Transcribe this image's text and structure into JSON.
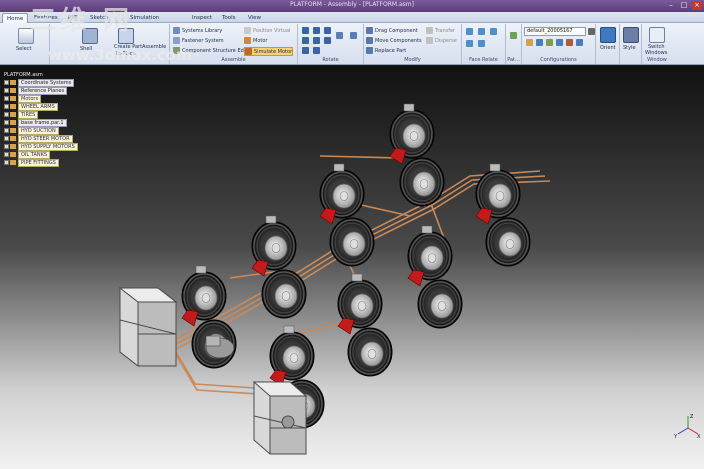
{
  "window": {
    "title": "PLATFORM - Assembly - [PLATFORM.asm]"
  },
  "menu": {
    "tabs": [
      "Home",
      "Features",
      "PMI",
      "Sketch",
      "Simulation",
      "Inspect",
      "Tools",
      "View"
    ]
  },
  "ribbon": {
    "select_label": "Select",
    "component_label": "Shell",
    "create_part_label": "Create Part",
    "in_place_label": "In-Place",
    "assemble_label": "Assemble",
    "systems_library_label": "Systems Library",
    "fastener_system_label": "Fastener System",
    "component_structure_label": "Component Structure Editor",
    "position_virtual_label": "Position Virtual",
    "motor_label": "Motor",
    "simulate_motor_label": "Simulate Motor",
    "assemble_group": "Assemble",
    "rotate_group": "Rotate",
    "drag_component_label": "Drag Component",
    "move_components_label": "Move Components",
    "replace_part_label": "Replace Part",
    "transfer_label": "Transfer",
    "disperse_label": "Disperse",
    "modify_group": "Modify",
    "face_relate_group": "Face Relate",
    "pattern_group": "Pat...",
    "config_value": "default_20005167",
    "configurations_group": "Configurations",
    "orient_label": "Orient",
    "style_label": "Style",
    "switch_label": "Switch",
    "windows_label": "Windows",
    "window_group": "Window"
  },
  "tree": {
    "root": "PLATFORM.asm",
    "items": [
      "Coordinate Systems",
      "Reference Planes",
      "Motors",
      "WHEEL ARMS",
      "TIRES",
      "base frame.par.1",
      "HYD SUCTION",
      "HYD STEER MOTOR",
      "HYD SUPPLY MOTORS",
      "OIL TANKS",
      "PIPE FITTINGS"
    ]
  },
  "watermark": {
    "line1": "三维 网",
    "line2": "www.3dmox.com"
  },
  "triad": {
    "x": "X",
    "y": "Y",
    "z": "Z"
  },
  "colors": {
    "title_bg": "#5b3d7a",
    "ribbon_bg": "#d6dfee",
    "hub_red": "#c41a1a",
    "pipe": "#d08a50"
  }
}
